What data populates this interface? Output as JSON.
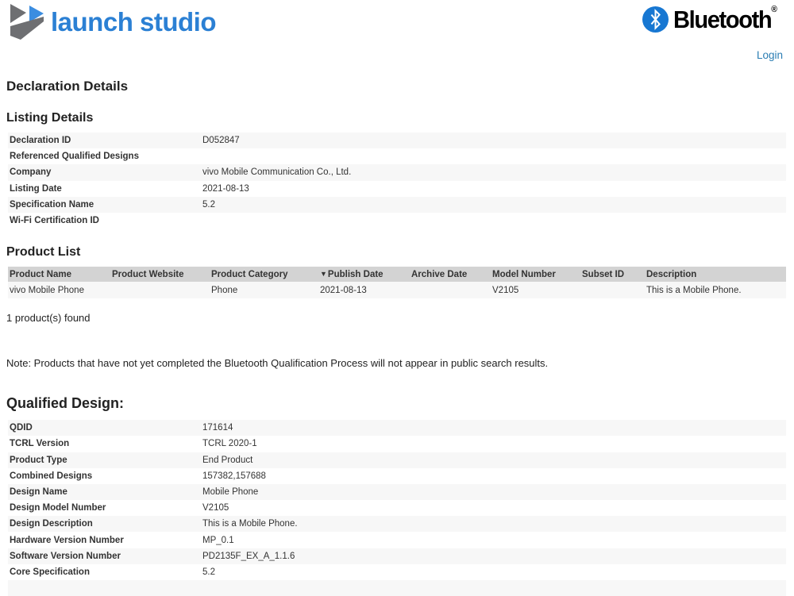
{
  "header": {
    "logo_text": "launch studio",
    "bluetooth_brand": "Bluetooth",
    "bluetooth_reg": "®",
    "login_label": "Login"
  },
  "page_title": "Declaration Details",
  "listing_details": {
    "title": "Listing Details",
    "rows": [
      {
        "label": "Declaration ID",
        "value": "D052847"
      },
      {
        "label": "Referenced Qualified Designs",
        "value": ""
      },
      {
        "label": "Company",
        "value": "vivo Mobile Communication Co., Ltd."
      },
      {
        "label": "Listing Date",
        "value": "2021-08-13"
      },
      {
        "label": "Specification Name",
        "value": "5.2"
      },
      {
        "label": "Wi-Fi Certification ID",
        "value": ""
      }
    ]
  },
  "product_list": {
    "title": "Product List",
    "columns": [
      "Product Name",
      "Product Website",
      "Product Category",
      "Publish Date",
      "Archive Date",
      "Model Number",
      "Subset ID",
      "Description"
    ],
    "sort_indicator": "▼",
    "sorted_column": "Publish Date",
    "rows": [
      {
        "product_name": "vivo Mobile Phone",
        "product_website": "",
        "product_category": "Phone",
        "publish_date": "2021-08-13",
        "archive_date": "",
        "model_number": "V2105",
        "subset_id": "",
        "description": "This is a Mobile Phone."
      }
    ],
    "count_text": "1 product(s) found"
  },
  "note": "Note: Products that have not yet completed the Bluetooth Qualification Process will not appear in public search results.",
  "qualified_design": {
    "title": "Qualified Design:",
    "rows": [
      {
        "label": "QDID",
        "value": "171614"
      },
      {
        "label": "TCRL Version",
        "value": "TCRL 2020-1"
      },
      {
        "label": "Product Type",
        "value": "End Product"
      },
      {
        "label": "Combined Designs",
        "value": "157382,157688"
      },
      {
        "label": "Design Name",
        "value": "Mobile Phone"
      },
      {
        "label": "Design Model Number",
        "value": "V2105"
      },
      {
        "label": "Design Description",
        "value": "This is a Mobile Phone."
      },
      {
        "label": "Hardware Version Number",
        "value": "MP_0.1"
      },
      {
        "label": "Software Version Number",
        "value": "PD2135F_EX_A_1.1.6"
      },
      {
        "label": "Core Specification",
        "value": "5.2"
      }
    ]
  },
  "colors": {
    "brand_blue": "#2b80d4",
    "bluetooth_blue": "#1777d2",
    "link_blue": "#2a7db3",
    "row_stripe": "#f7f7f7",
    "table_header_bg": "#d3d3d3",
    "text_dark": "#333333"
  }
}
